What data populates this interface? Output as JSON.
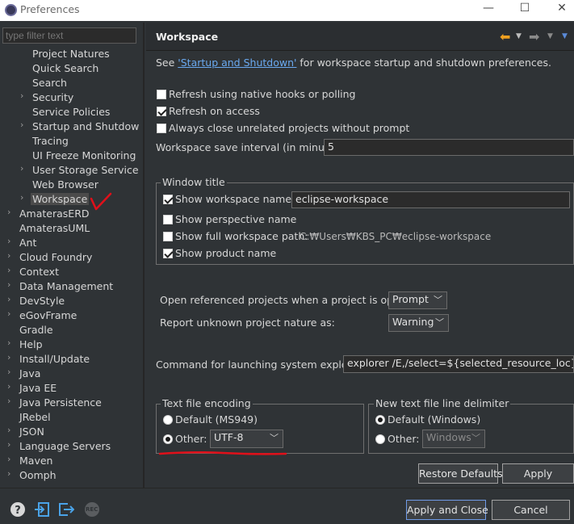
{
  "window": {
    "title": "Preferences",
    "minimize": "—",
    "maximize": "☐",
    "close": "✕"
  },
  "filter": {
    "placeholder": "type filter text"
  },
  "tree": {
    "items": [
      {
        "label": "Project Natures",
        "indent": 2,
        "arrow": false
      },
      {
        "label": "Quick Search",
        "indent": 2,
        "arrow": false
      },
      {
        "label": "Search",
        "indent": 2,
        "arrow": false
      },
      {
        "label": "Security",
        "indent": 2,
        "arrow": true
      },
      {
        "label": "Service Policies",
        "indent": 2,
        "arrow": false
      },
      {
        "label": "Startup and Shutdown",
        "indent": 2,
        "arrow": true
      },
      {
        "label": "Tracing",
        "indent": 2,
        "arrow": false
      },
      {
        "label": "UI Freeze Monitoring",
        "indent": 2,
        "arrow": false
      },
      {
        "label": "User Storage Service",
        "indent": 2,
        "arrow": true
      },
      {
        "label": "Web Browser",
        "indent": 2,
        "arrow": false
      },
      {
        "label": "Workspace",
        "indent": 2,
        "arrow": true,
        "selected": true
      },
      {
        "label": "AmaterasERD",
        "indent": 1,
        "arrow": true
      },
      {
        "label": "AmaterasUML",
        "indent": 1,
        "arrow": false
      },
      {
        "label": "Ant",
        "indent": 1,
        "arrow": true
      },
      {
        "label": "Cloud Foundry",
        "indent": 1,
        "arrow": true
      },
      {
        "label": "Context",
        "indent": 1,
        "arrow": true
      },
      {
        "label": "Data Management",
        "indent": 1,
        "arrow": true
      },
      {
        "label": "DevStyle",
        "indent": 1,
        "arrow": true
      },
      {
        "label": "eGovFrame",
        "indent": 1,
        "arrow": true
      },
      {
        "label": "Gradle",
        "indent": 1,
        "arrow": false
      },
      {
        "label": "Help",
        "indent": 1,
        "arrow": true
      },
      {
        "label": "Install/Update",
        "indent": 1,
        "arrow": true
      },
      {
        "label": "Java",
        "indent": 1,
        "arrow": true
      },
      {
        "label": "Java EE",
        "indent": 1,
        "arrow": true
      },
      {
        "label": "Java Persistence",
        "indent": 1,
        "arrow": true
      },
      {
        "label": "JRebel",
        "indent": 1,
        "arrow": false
      },
      {
        "label": "JSON",
        "indent": 1,
        "arrow": true
      },
      {
        "label": "Language Servers",
        "indent": 1,
        "arrow": true
      },
      {
        "label": "Maven",
        "indent": 1,
        "arrow": true
      },
      {
        "label": "Oomph",
        "indent": 1,
        "arrow": true
      }
    ]
  },
  "page": {
    "title": "Workspace",
    "see_prefix": "See ",
    "see_link": "'Startup and Shutdown'",
    "see_suffix": " for workspace startup and shutdown preferences.",
    "refresh_native": "Refresh using native hooks or polling",
    "refresh_access": "Refresh on access",
    "always_close": "Always close unrelated projects without prompt",
    "save_interval_label": "Workspace save interval (in minutes):",
    "save_interval_value": "5",
    "window_title_group": "Window title",
    "show_ws_name": "Show workspace name:",
    "ws_name_value": "eclipse-workspace",
    "show_perspective": "Show perspective name",
    "show_full_path": "Show full workspace path:",
    "full_path_value": "C:₩Users₩KBS_PC₩eclipse-workspace",
    "show_product": "Show product name",
    "open_ref_label": "Open referenced projects when a project is opened:",
    "open_ref_value": "Prompt",
    "report_unknown_label": "Report unknown project nature as:",
    "report_unknown_value": "Warning",
    "cmd_label": "Command for launching system explorer:",
    "cmd_value": "explorer /E,/select=${selected_resource_loc}",
    "encoding_group": "Text file encoding",
    "enc_default": "Default (MS949)",
    "enc_other": "Other:",
    "enc_value": "UTF-8",
    "delim_group": "New text file line delimiter",
    "delim_default": "Default (Windows)",
    "delim_other": "Other:",
    "delim_value": "Windows",
    "restore_defaults": "Restore Defaults",
    "apply": "Apply"
  },
  "footer": {
    "apply_close": "Apply and Close",
    "cancel": "Cancel",
    "rec_label": "REC"
  },
  "colors": {
    "link": "#6aa9f0",
    "annotation": "#e0101a",
    "nav_arrow": "#f0a020"
  }
}
